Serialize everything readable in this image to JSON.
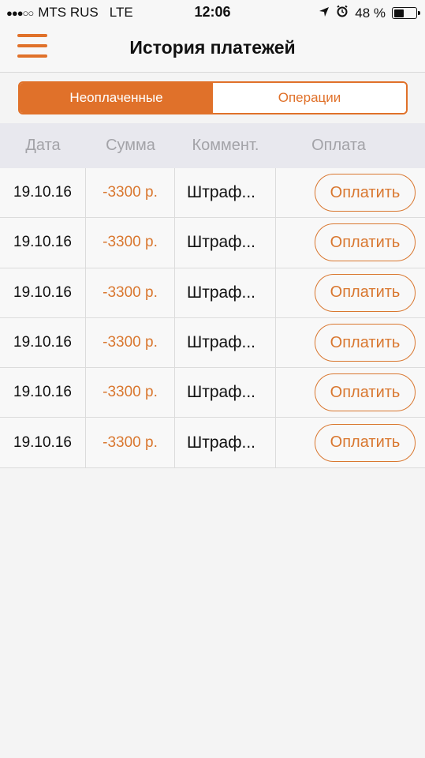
{
  "status_bar": {
    "signal": "●●●○○",
    "carrier": "MTS RUS",
    "network": "LTE",
    "time": "12:06",
    "battery_percent": "48 %",
    "battery_level": 0.48,
    "location_icon": "location-arrow-icon",
    "alarm_icon": "alarm-clock-icon"
  },
  "nav": {
    "title": "История платежей",
    "menu_icon": "hamburger-menu-icon"
  },
  "segments": {
    "unpaid": "Неоплаченные",
    "operations": "Операции",
    "active": "unpaid"
  },
  "table": {
    "headers": [
      "Дата",
      "Сумма",
      "Коммент.",
      "Оплата"
    ],
    "rows": [
      {
        "date": "19.10.16",
        "amount": "-3300 р.",
        "comment": "Штраф...",
        "action": "Оплатить"
      },
      {
        "date": "19.10.16",
        "amount": "-3300 р.",
        "comment": "Штраф...",
        "action": "Оплатить"
      },
      {
        "date": "19.10.16",
        "amount": "-3300 р.",
        "comment": "Штраф...",
        "action": "Оплатить"
      },
      {
        "date": "19.10.16",
        "amount": "-3300 р.",
        "comment": "Штраф...",
        "action": "Оплатить"
      },
      {
        "date": "19.10.16",
        "amount": "-3300 р.",
        "comment": "Штраф...",
        "action": "Оплатить"
      },
      {
        "date": "19.10.16",
        "amount": "-3300 р.",
        "comment": "Штраф...",
        "action": "Оплатить"
      }
    ]
  },
  "colors": {
    "accent": "#e0712a",
    "amount": "#d9772f",
    "header_text": "#a3a3a8"
  }
}
